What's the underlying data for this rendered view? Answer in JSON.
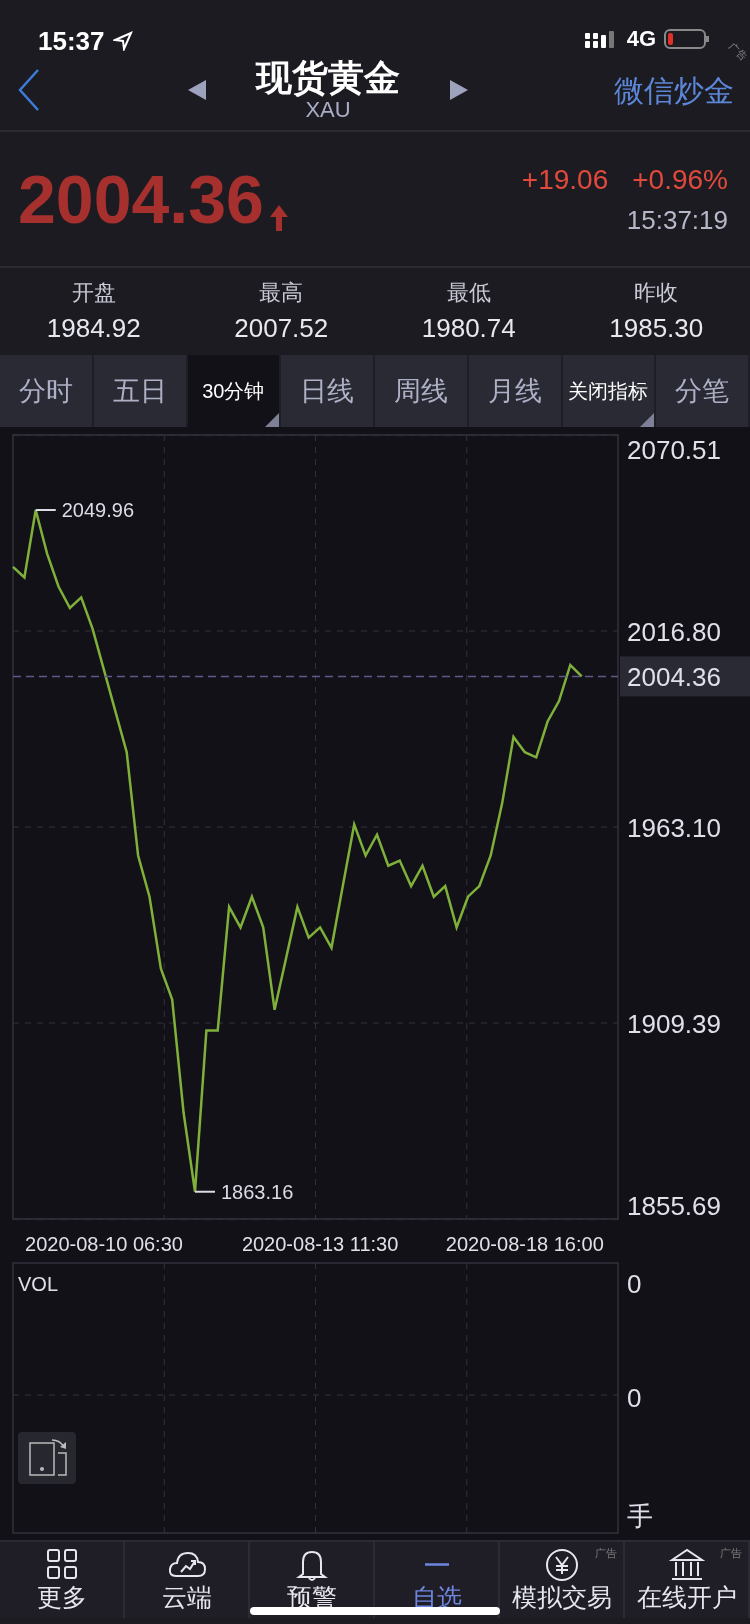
{
  "status_bar": {
    "time": "15:37",
    "network": "4G"
  },
  "header": {
    "title": "现货黄金",
    "subtitle": "XAU",
    "action": "微信炒金",
    "ad_tag": "广告"
  },
  "quote": {
    "price": "2004.36",
    "change": "+19.06",
    "change_percent": "+0.96%",
    "time": "15:37:19"
  },
  "stats": [
    {
      "label": "开盘",
      "value": "1984.92"
    },
    {
      "label": "最高",
      "value": "2007.52"
    },
    {
      "label": "最低",
      "value": "1980.74"
    },
    {
      "label": "昨收",
      "value": "1985.30"
    }
  ],
  "period_tabs": [
    {
      "label": "分时",
      "selected": false,
      "dropdown": false
    },
    {
      "label": "五日",
      "selected": false,
      "dropdown": false
    },
    {
      "label": "30分钟",
      "selected": true,
      "dropdown": true
    },
    {
      "label": "日线",
      "selected": false,
      "dropdown": false
    },
    {
      "label": "周线",
      "selected": false,
      "dropdown": false
    },
    {
      "label": "月线",
      "selected": false,
      "dropdown": false
    },
    {
      "label": "关闭指标",
      "selected": false,
      "dropdown": true
    },
    {
      "label": "分笔",
      "selected": false,
      "dropdown": false
    }
  ],
  "price_chart": {
    "chart_data": {
      "type": "line",
      "grid": true,
      "ylim": [
        1855.69,
        2070.51
      ],
      "yticks": [
        {
          "value": 1855.69,
          "label": "1855.69"
        },
        {
          "value": 1909.39,
          "label": "1909.39"
        },
        {
          "value": 1963.1,
          "label": "1963.10"
        },
        {
          "value": 2016.8,
          "label": "2016.80"
        },
        {
          "value": 2070.51,
          "label": "2070.51"
        }
      ],
      "categories": [
        null,
        null,
        null,
        null,
        null,
        null,
        null,
        null,
        "2020-08-10 06:30",
        null,
        null,
        null,
        null,
        null,
        null,
        null,
        null,
        null,
        null,
        null,
        null,
        null,
        null,
        null,
        null,
        null,
        null,
        "2020-08-13 11:30",
        null,
        null,
        null,
        null,
        null,
        null,
        null,
        null,
        null,
        null,
        null,
        null,
        null,
        null,
        null,
        null,
        null,
        "2020-08-18 16:00",
        null,
        null,
        null,
        null,
        null
      ],
      "series": [
        {
          "color": "#7fb03a",
          "values": [
            2034.4,
            2031.5,
            2049.96,
            2038,
            2029,
            2023.1,
            2026,
            2017.4,
            2006.1,
            1994.8,
            1983.6,
            1955.3,
            1944,
            1924.3,
            1915.8,
            1884.8,
            1863.16,
            1907.3,
            1907.3,
            1941.2,
            1935.6,
            1944,
            1935.6,
            1913,
            1927.1,
            1941.2,
            1932.8,
            1935.6,
            1930,
            1946.9,
            1963.8,
            1955.3,
            1961,
            1952.5,
            1953.9,
            1946.9,
            1952.5,
            1944,
            1946.9,
            1935.6,
            1944,
            1946.9,
            1955.3,
            1969.5,
            1987.8,
            1983.6,
            1982.2,
            1992,
            1997.6,
            2007.5,
            2004.4
          ]
        }
      ],
      "annotations": [
        "2049.96",
        "1863.16"
      ]
    },
    "current_marker": {
      "label": "2004.36"
    }
  },
  "volume_panel": {
    "title": "VOL",
    "axis_labels": [
      "0",
      "0",
      "手"
    ]
  },
  "bottom_nav": [
    {
      "label": "更多",
      "kind": "grid",
      "selected": false
    },
    {
      "label": "云端",
      "kind": "cloud",
      "selected": false
    },
    {
      "label": "预警",
      "kind": "bell",
      "selected": false
    },
    {
      "label": "自选",
      "kind": "dash",
      "selected": true
    },
    {
      "label": "模拟交易",
      "kind": "yen",
      "selected": false,
      "tag": "广告"
    },
    {
      "label": "在线开户",
      "kind": "bank",
      "selected": false,
      "tag": "广告"
    }
  ]
}
